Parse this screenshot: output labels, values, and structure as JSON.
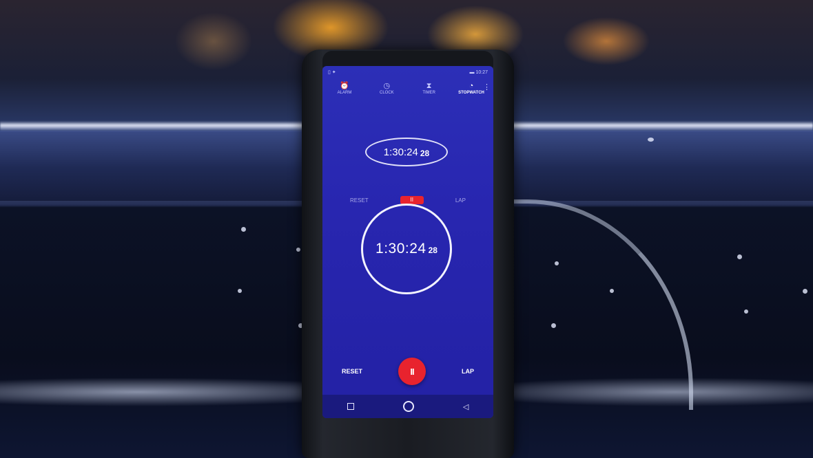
{
  "status_bar": {
    "left": "▯ ✦",
    "right": "▬ 10:27"
  },
  "tabs": [
    {
      "label": "ALARM",
      "icon": "⏰"
    },
    {
      "label": "CLOCK",
      "icon": "◷"
    },
    {
      "label": "TIMER",
      "icon": "⧗"
    },
    {
      "label": "STOPWATCH",
      "icon": "◔"
    }
  ],
  "overflow_icon": "⋮",
  "stopwatch": {
    "time": "1:30:24",
    "hundredths": "28"
  },
  "controls": {
    "reset_label": "RESET",
    "lap_label": "LAP",
    "pause_glyph": "II"
  },
  "reflection": {
    "reset_label": "RESET",
    "lap_label": "LAP",
    "pause_glyph": "II"
  },
  "navigation": {
    "back_glyph": "◁"
  },
  "colors": {
    "screen_blue": "#2c2fb7",
    "pause_red": "#e8232e",
    "ring_white": "#f3f3ff"
  }
}
